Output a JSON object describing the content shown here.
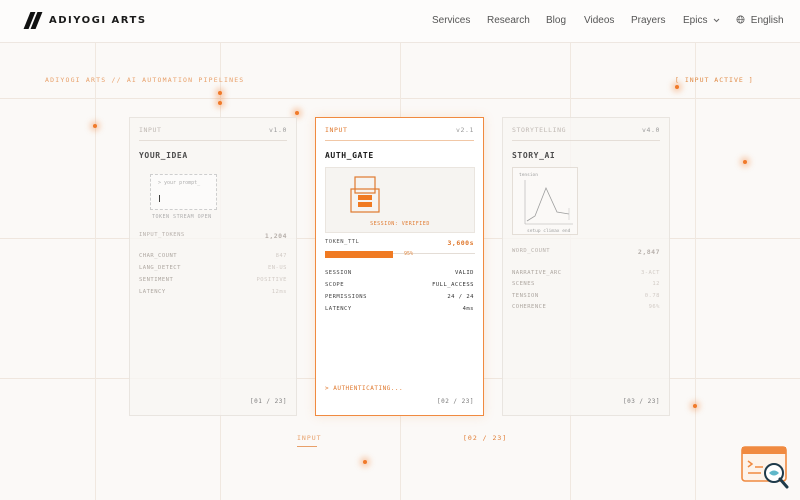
{
  "brand": {
    "name": "ADIYOGI ARTS"
  },
  "nav": {
    "items": [
      "Services",
      "Research",
      "Blog",
      "Videos",
      "Prayers",
      "Epics"
    ],
    "language": "English"
  },
  "page": {
    "breadcrumb": "ADIYOGI ARTS // AI AUTOMATION PIPELINES",
    "status": "[ INPUT ACTIVE ]",
    "bottom_tab": "INPUT",
    "bottom_counter": "[02 / 23]"
  },
  "cards": [
    {
      "label": "INPUT",
      "version": "v1.0",
      "title": "YOUR_IDEA",
      "prompt_placeholder": "> your prompt_",
      "prompt_caption": "TOKEN STREAM OPEN",
      "primary": {
        "label": "INPUT_TOKENS",
        "value": "1,204"
      },
      "metrics": [
        {
          "label": "CHAR_COUNT",
          "value": "847"
        },
        {
          "label": "LANG_DETECT",
          "value": "EN-US"
        },
        {
          "label": "SENTIMENT",
          "value": "POSITIVE"
        },
        {
          "label": "LATENCY",
          "value": "12ms"
        }
      ],
      "footer": "[01 / 23]"
    },
    {
      "label": "INPUT",
      "version": "v2.1",
      "title": "AUTH_GATE",
      "session_text": "SESSION: VERIFIED",
      "primary": {
        "label": "TOKEN_TTL",
        "value": "3,600s"
      },
      "progress": {
        "percent": 95,
        "label": "95%"
      },
      "metrics": [
        {
          "label": "SESSION",
          "value": "VALID"
        },
        {
          "label": "SCOPE",
          "value": "FULL_ACCESS"
        },
        {
          "label": "PERMISSIONS",
          "value": "24 / 24"
        },
        {
          "label": "LATENCY",
          "value": "4ms"
        }
      ],
      "state": "> AUTHENTICATING...",
      "footer": "[02 / 23]"
    },
    {
      "label": "STORYTELLING",
      "version": "v4.0",
      "title": "STORY_AI",
      "chart_title": "tension",
      "chart_ticks": "setup climax end",
      "primary": {
        "label": "WORD_COUNT",
        "value": "2,847"
      },
      "metrics": [
        {
          "label": "NARRATIVE_ARC",
          "value": "3-ACT"
        },
        {
          "label": "SCENES",
          "value": "12"
        },
        {
          "label": "TENSION",
          "value": "0.78"
        },
        {
          "label": "COHERENCE",
          "value": "96%"
        }
      ],
      "footer": "[03 / 23]"
    }
  ],
  "colors": {
    "accent": "#f07a22",
    "accent_soft": "#e8a06a",
    "border": "#e9e4df"
  },
  "icons": [
    "brand-logo-icon",
    "chevron-down-icon",
    "globe-icon",
    "lock-icon",
    "terminal-search-icon"
  ]
}
